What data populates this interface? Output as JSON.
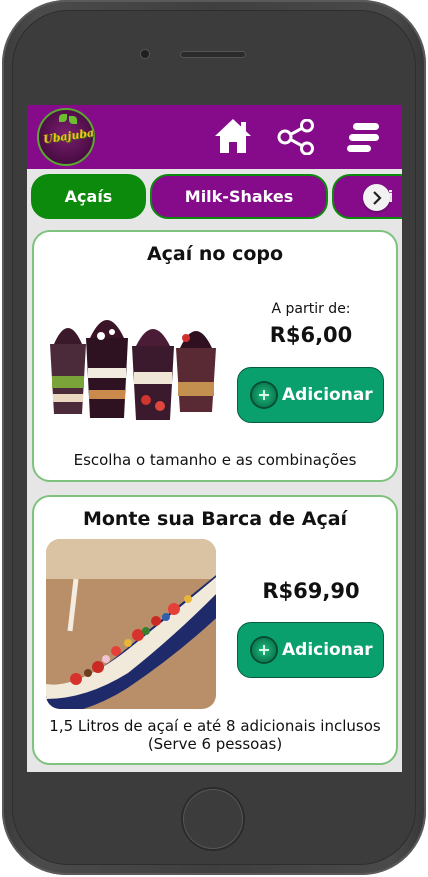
{
  "header": {
    "logo_text": "Ubajuba",
    "home_icon": "home-icon",
    "share_icon": "share-icon",
    "menu_icon": "menu-icon",
    "bar_color": "#850b8a"
  },
  "tabs": {
    "items": [
      {
        "label": "Açaís",
        "active": true
      },
      {
        "label": "Milk-Shakes",
        "active": false
      },
      {
        "label": "Pi",
        "active": false
      }
    ],
    "next_icon": "chevron-right-icon",
    "active_color": "#0b8a0b"
  },
  "products": [
    {
      "title": "Açaí no copo",
      "from_label": "A partir de:",
      "price": "R$6,00",
      "button_label": "Adicionar",
      "description": "Escolha o tamanho e as combinações"
    },
    {
      "title": "Monte sua Barca de Açaí",
      "price": "R$69,90",
      "button_label": "Adicionar",
      "description_line1": "1,5 Litros de açaí e até 8 adicionais inclusos",
      "description_line2": "(Serve 6 pessoas)"
    }
  ],
  "button_color": "#0aa06e"
}
